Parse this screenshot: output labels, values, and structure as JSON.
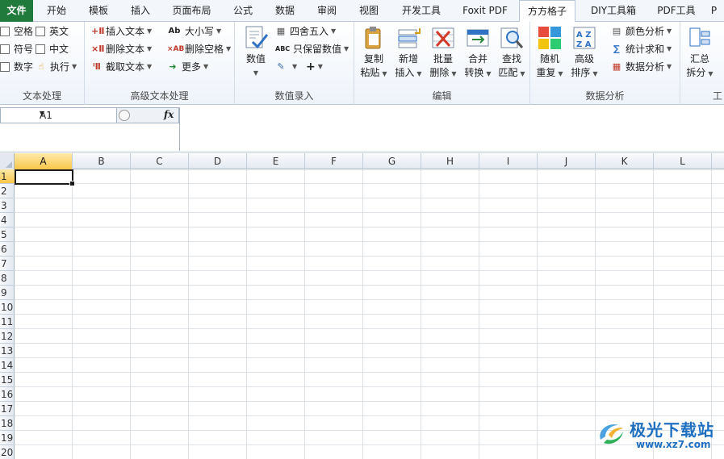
{
  "tabs": [
    {
      "label": "文件",
      "kind": "file"
    },
    {
      "label": "开始"
    },
    {
      "label": "模板"
    },
    {
      "label": "插入"
    },
    {
      "label": "页面布局"
    },
    {
      "label": "公式"
    },
    {
      "label": "数据"
    },
    {
      "label": "审阅"
    },
    {
      "label": "视图"
    },
    {
      "label": "开发工具"
    },
    {
      "label": "Foxit PDF"
    },
    {
      "label": "方方格子",
      "active": true
    },
    {
      "label": "DIY工具箱"
    },
    {
      "label": "PDF工具"
    },
    {
      "label": "P"
    }
  ],
  "ribbon": {
    "text_group": {
      "label": "文本处理",
      "items": [
        "空格",
        "英文",
        "符号",
        "中文",
        "数字"
      ],
      "execute": "执行"
    },
    "adv_text_group": {
      "label": "高级文本处理",
      "insert_text": "插入文本",
      "delete_text": "删除文本",
      "extract_text": "截取文本",
      "case": "大小写",
      "delete_space": "删除空格",
      "more": "更多"
    },
    "value_group": {
      "label": "数值录入",
      "value": "数值",
      "round": "四舍五入",
      "keep_value": "只保留数值",
      "plus": "+"
    },
    "edit_group": {
      "label": "编辑",
      "buttons": [
        {
          "l1": "复制",
          "l2": "粘贴"
        },
        {
          "l1": "新增",
          "l2": "插入"
        },
        {
          "l1": "批量",
          "l2": "删除"
        },
        {
          "l1": "合并",
          "l2": "转换"
        },
        {
          "l1": "查找",
          "l2": "匹配"
        }
      ]
    },
    "analysis_group": {
      "label": "数据分析",
      "random": {
        "l1": "随机",
        "l2": "重复"
      },
      "sort": {
        "l1": "高级",
        "l2": "排序"
      },
      "color_analysis": "颜色分析",
      "stat_sum": "统计求和",
      "data_analysis": "数据分析"
    },
    "last_group": {
      "summary": {
        "l1": "汇总",
        "l2": "拆分"
      },
      "label_partial": "工"
    }
  },
  "formula_bar": {
    "name_box": "A1",
    "fx": "fx",
    "formula": ""
  },
  "sheet": {
    "columns": [
      "A",
      "B",
      "C",
      "D",
      "E",
      "F",
      "G",
      "H",
      "I",
      "J",
      "K",
      "L"
    ],
    "rows": [
      "1",
      "2",
      "3",
      "4",
      "5",
      "6",
      "7",
      "8",
      "9",
      "10",
      "11",
      "12",
      "13",
      "14",
      "15",
      "16",
      "17",
      "18",
      "19",
      "20"
    ],
    "selected_cell": "A1"
  },
  "watermark": {
    "title": "极光下载站",
    "url": "www.xz7.com"
  }
}
